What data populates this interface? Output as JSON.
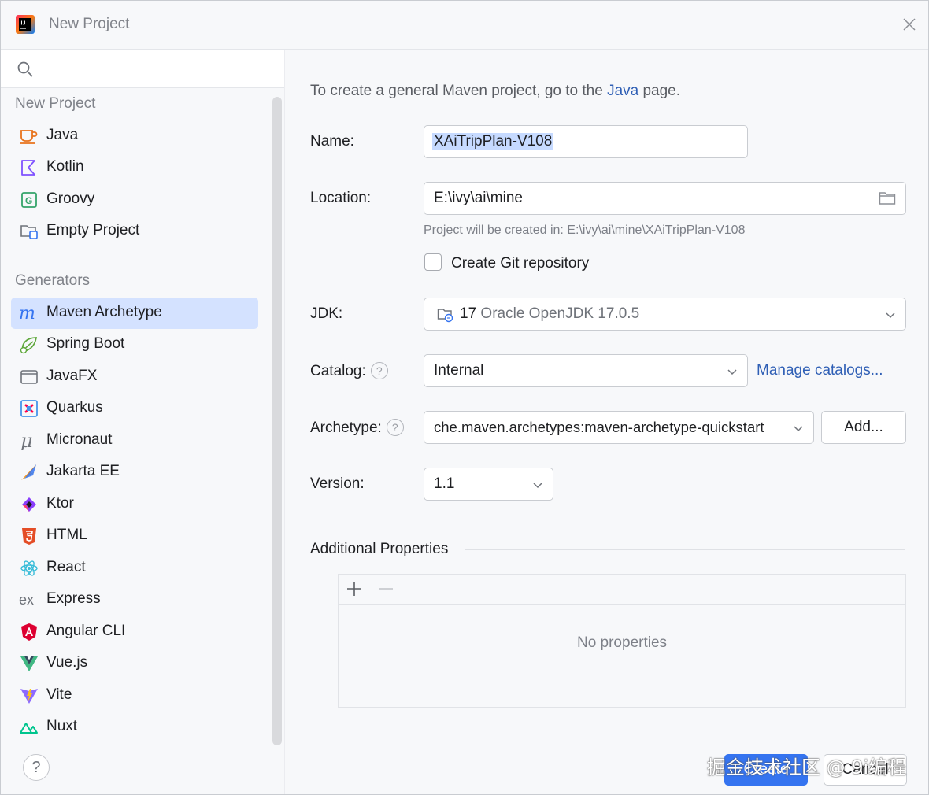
{
  "window": {
    "title": "New Project"
  },
  "sidebar": {
    "search_placeholder": "",
    "section_new_project": "New Project",
    "section_generators": "Generators",
    "new_project_items": [
      {
        "label": "Java",
        "icon": "java-cup-icon"
      },
      {
        "label": "Kotlin",
        "icon": "kotlin-icon"
      },
      {
        "label": "Groovy",
        "icon": "groovy-icon"
      },
      {
        "label": "Empty Project",
        "icon": "empty-project-icon"
      }
    ],
    "generator_items": [
      {
        "label": "Maven Archetype",
        "icon": "maven-icon",
        "selected": true
      },
      {
        "label": "Spring Boot",
        "icon": "spring-boot-icon"
      },
      {
        "label": "JavaFX",
        "icon": "javafx-icon"
      },
      {
        "label": "Quarkus",
        "icon": "quarkus-icon"
      },
      {
        "label": "Micronaut",
        "icon": "micronaut-icon"
      },
      {
        "label": "Jakarta EE",
        "icon": "jakarta-ee-icon"
      },
      {
        "label": "Ktor",
        "icon": "ktor-icon"
      },
      {
        "label": "HTML",
        "icon": "html5-icon"
      },
      {
        "label": "React",
        "icon": "react-icon"
      },
      {
        "label": "Express",
        "icon": "express-icon"
      },
      {
        "label": "Angular CLI",
        "icon": "angular-icon"
      },
      {
        "label": "Vue.js",
        "icon": "vue-icon"
      },
      {
        "label": "Vite",
        "icon": "vite-icon"
      },
      {
        "label": "Nuxt",
        "icon": "nuxt-icon"
      }
    ],
    "help": "?"
  },
  "form": {
    "hint_prefix": "To create a general Maven project, go to the ",
    "hint_link": "Java",
    "hint_suffix": " page.",
    "name_label": "Name:",
    "name_value": "XAiTripPlan-V108",
    "location_label": "Location:",
    "location_value": "E:\\ivy\\ai\\mine",
    "location_hint": "Project will be created in: E:\\ivy\\ai\\mine\\XAiTripPlan-V108",
    "git_label": "Create Git repository",
    "git_checked": false,
    "jdk_label": "JDK:",
    "jdk_version": "17",
    "jdk_name": "Oracle OpenJDK 17.0.5",
    "catalog_label": "Catalog:",
    "catalog_value": "Internal",
    "manage_catalogs": "Manage catalogs...",
    "archetype_label": "Archetype:",
    "archetype_value": "che.maven.archetypes:maven-archetype-quickstart",
    "add_button": "Add...",
    "version_label": "Version:",
    "version_value": "1.1",
    "additional_properties": "Additional Properties",
    "no_properties": "No properties",
    "help_mark": "?"
  },
  "footer": {
    "create": "Create",
    "cancel": "Cancel",
    "watermark": "掘金技术社区 @ 9i编程"
  },
  "colors": {
    "accent": "#3574f0",
    "selection": "#d4e2ff",
    "link": "#2f5fb5"
  }
}
